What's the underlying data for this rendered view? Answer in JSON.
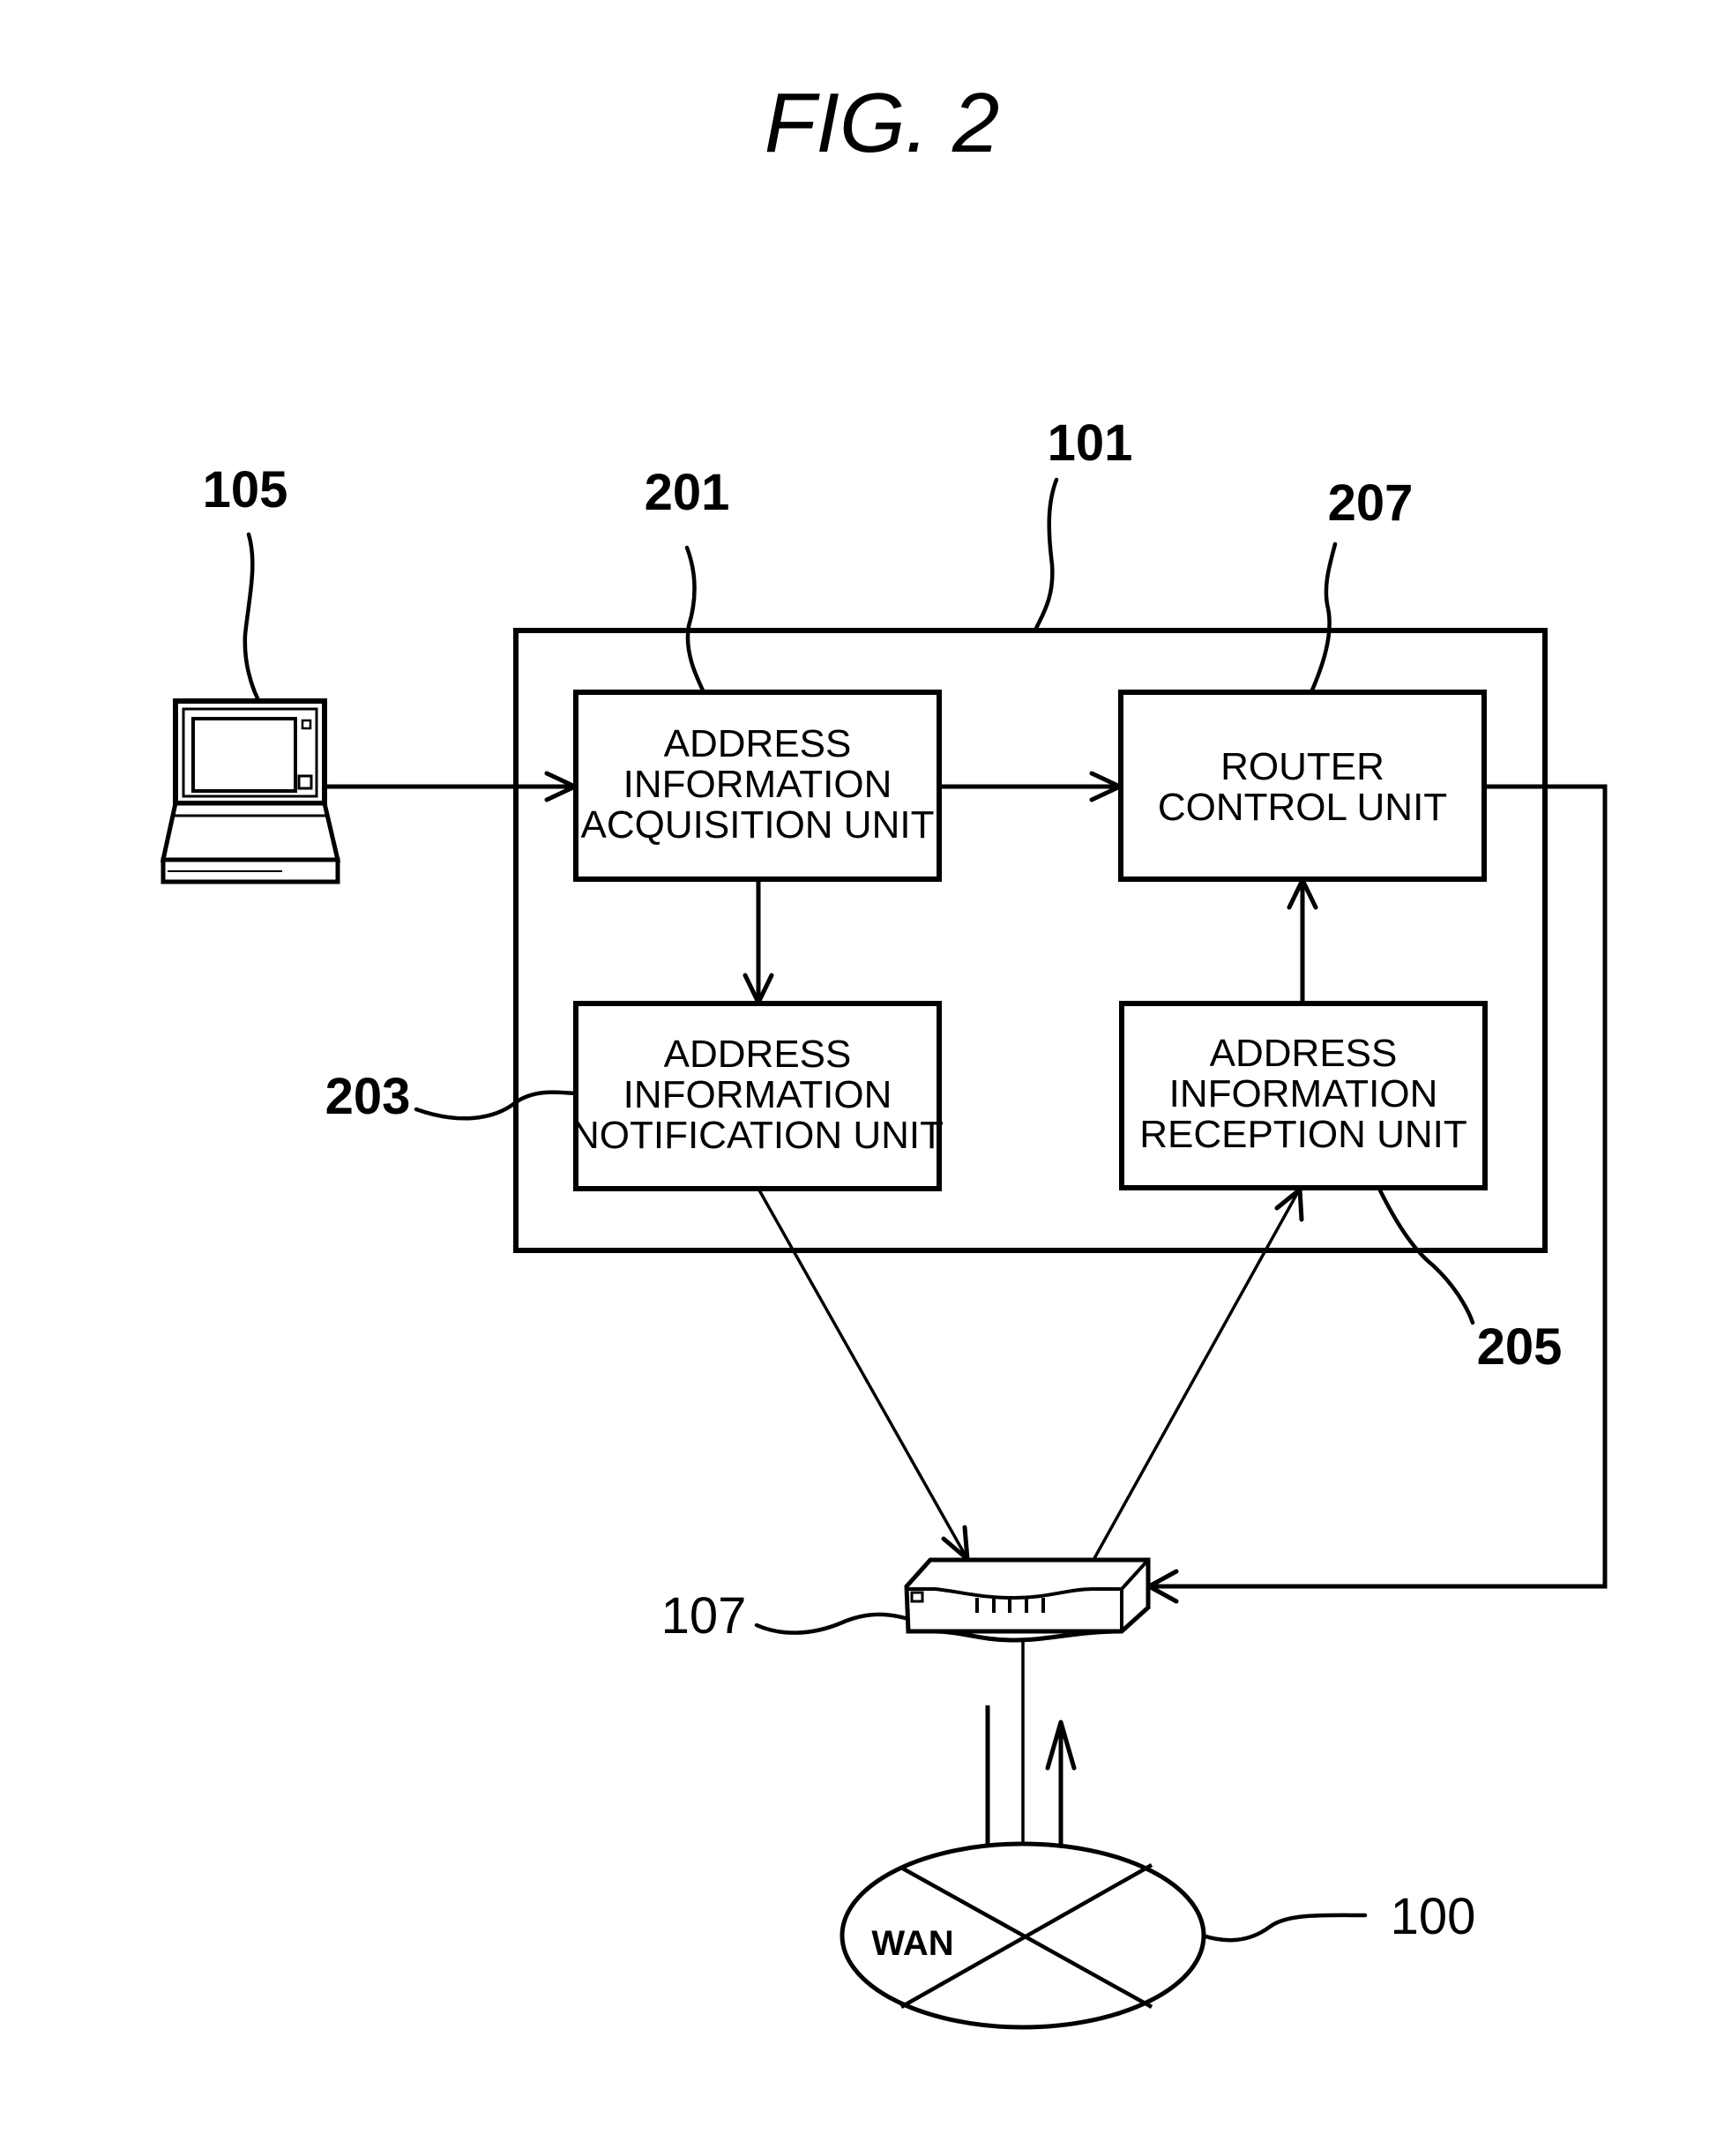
{
  "figure": {
    "title": "FIG. 2"
  },
  "reference_labels": {
    "device_101": "101",
    "terminal_105": "105",
    "router_107": "107",
    "wan_100": "100",
    "unit_201": "201",
    "unit_203": "203",
    "unit_205": "205",
    "unit_207": "207"
  },
  "units": {
    "acquisition": {
      "ref": "201",
      "lines": [
        "ADDRESS",
        "INFORMATION",
        "ACQUISITION UNIT"
      ]
    },
    "notification": {
      "ref": "203",
      "lines": [
        "ADDRESS",
        "INFORMATION",
        "NOTIFICATION UNIT"
      ]
    },
    "reception": {
      "ref": "205",
      "lines": [
        "ADDRESS",
        "INFORMATION",
        "RECEPTION UNIT"
      ]
    },
    "router_control": {
      "ref": "207",
      "lines": [
        "ROUTER",
        "CONTROL UNIT"
      ]
    }
  },
  "network": {
    "wan_label": "WAN"
  },
  "icons": {
    "terminal": "laptop-icon",
    "router": "router-icon",
    "wan": "network-cloud-icon"
  },
  "connections": [
    {
      "from": "105",
      "to": "201"
    },
    {
      "from": "201",
      "to": "207"
    },
    {
      "from": "201",
      "to": "203"
    },
    {
      "from": "205",
      "to": "207"
    },
    {
      "from": "203",
      "to": "107"
    },
    {
      "from": "107",
      "to": "205"
    },
    {
      "from": "207",
      "to": "107"
    },
    {
      "from": "107",
      "to": "100"
    },
    {
      "from": "100",
      "to": "107"
    }
  ],
  "colors": {
    "line": "#000000",
    "background": "#ffffff"
  }
}
